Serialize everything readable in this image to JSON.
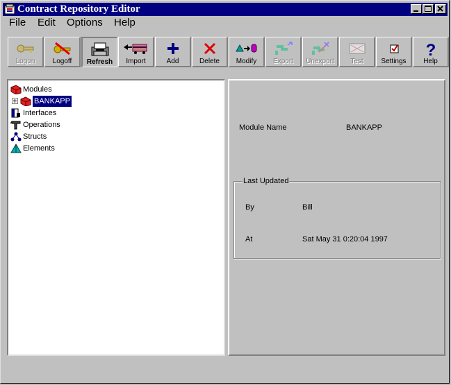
{
  "window": {
    "title": "Contract Repository Editor"
  },
  "menu": [
    "File",
    "Edit",
    "Options",
    "Help"
  ],
  "toolbar": [
    {
      "label": "Logon",
      "icon": "key-icon",
      "state": "disabled"
    },
    {
      "label": "Logoff",
      "icon": "logoff-key-icon",
      "state": "normal"
    },
    {
      "label": "Refresh",
      "icon": "refresh-icon",
      "state": "pressed"
    },
    {
      "label": "Import",
      "icon": "import-truck-icon",
      "state": "normal"
    },
    {
      "label": "Add",
      "icon": "plus-icon",
      "state": "normal"
    },
    {
      "label": "Delete",
      "icon": "delete-x-icon",
      "state": "normal"
    },
    {
      "label": "Modify",
      "icon": "modify-shapes-icon",
      "state": "normal"
    },
    {
      "label": "Export",
      "icon": "export-icon",
      "state": "disabled"
    },
    {
      "label": "Unexport",
      "icon": "unexport-icon",
      "state": "disabled"
    },
    {
      "label": "Test",
      "icon": "test-icon",
      "state": "disabled"
    },
    {
      "label": "Settings",
      "icon": "settings-checkbox-icon",
      "state": "normal"
    },
    {
      "label": "Help",
      "icon": "question-icon",
      "state": "normal"
    }
  ],
  "tree": [
    {
      "label": "Modules",
      "icon": "modules-icon",
      "level": 0
    },
    {
      "label": "BANKAPP",
      "icon": "module-icon",
      "level": 1,
      "selected": true,
      "expander": "+"
    },
    {
      "label": "Interfaces",
      "icon": "interfaces-icon",
      "level": 0
    },
    {
      "label": "Operations",
      "icon": "operations-icon",
      "level": 0
    },
    {
      "label": "Structs",
      "icon": "structs-icon",
      "level": 0
    },
    {
      "label": "Elements",
      "icon": "elements-icon",
      "level": 0
    }
  ],
  "details": {
    "module_name_label": "Module Name",
    "module_name_value": "BANKAPP",
    "last_updated_title": "Last Updated",
    "by_label": "By",
    "by_value": "Bill",
    "at_label": "At",
    "at_value": "Sat May 31  0:20:04 1997"
  },
  "colors": {
    "titlebar": "#000080",
    "face": "#c0c0c0",
    "selection": "#000080"
  }
}
